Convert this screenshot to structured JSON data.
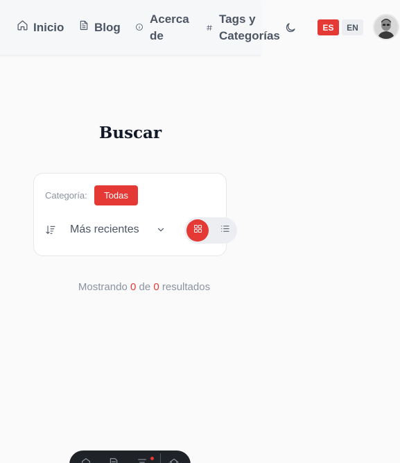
{
  "nav": {
    "items": [
      {
        "label": "Inicio",
        "icon": "home-icon"
      },
      {
        "label": "Blog",
        "icon": "document-icon"
      },
      {
        "label": "Acerca de",
        "icon": "info-icon"
      },
      {
        "label": "Tags y Categorías",
        "icon": "hash-icon"
      }
    ],
    "theme_icon": "moon-icon",
    "languages": [
      {
        "code": "ES",
        "active": true
      },
      {
        "code": "EN",
        "active": false
      }
    ],
    "avatar_icon": "user-avatar"
  },
  "page": {
    "title": "Buscar"
  },
  "filters": {
    "category_label": "Categoría:",
    "category_selected": "Todas",
    "sort_selected": "Más recientes",
    "view_modes": [
      {
        "name": "grid",
        "icon": "grid-icon",
        "active": true
      },
      {
        "name": "list",
        "icon": "list-icon",
        "active": false
      }
    ]
  },
  "results": {
    "prefix": "Mostrando",
    "shown": "0",
    "middle": "de",
    "total": "0",
    "suffix": "resultados"
  },
  "colors": {
    "accent": "#e53935",
    "background": "#fafafa",
    "text": "#4b5563",
    "dock": "#1f2226"
  }
}
